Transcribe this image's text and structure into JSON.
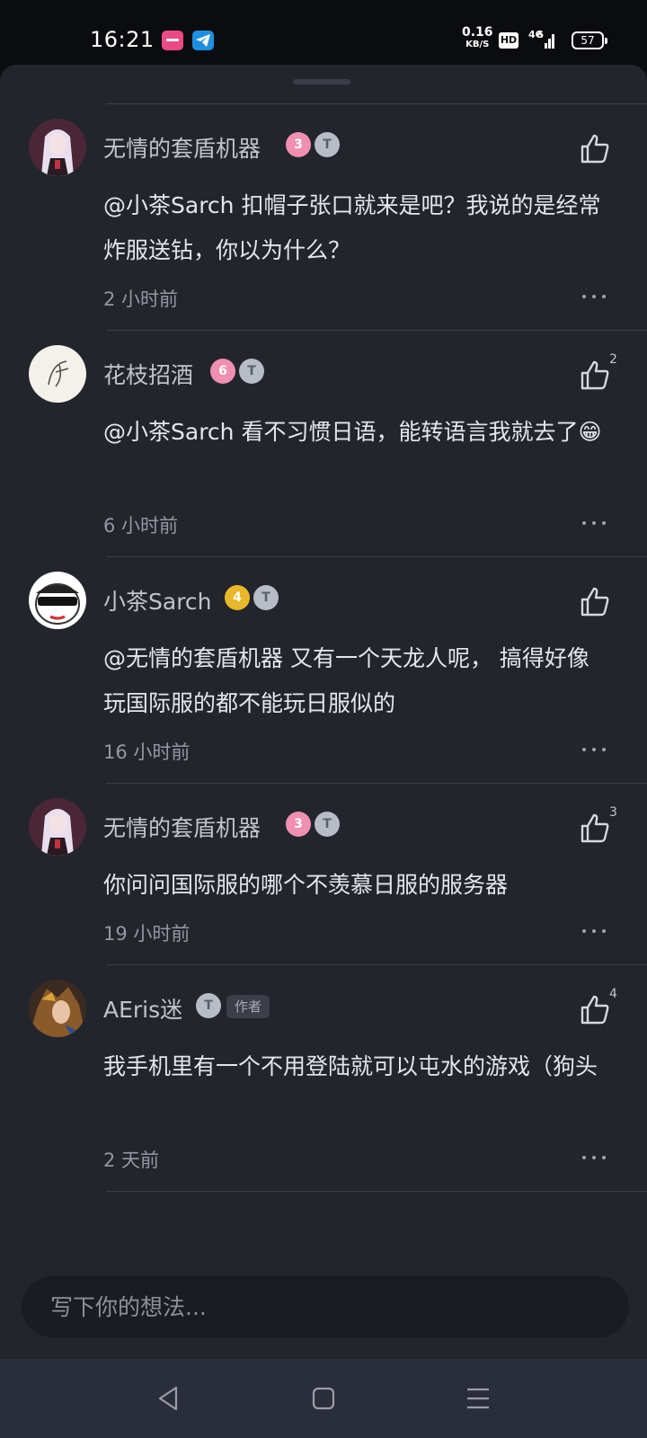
{
  "status_bar": {
    "time": "16:21",
    "app_icons": [
      "app-icon-pink",
      "telegram-icon"
    ],
    "net_speed": "0.16",
    "net_unit": "KB/S",
    "hd": "HD",
    "network": "4G",
    "battery": "57"
  },
  "comments": [
    {
      "username": "无情的套盾机器",
      "level_badge": "3",
      "title_badge": "T",
      "mention": "@小茶Sarch",
      "text": " 扣帽子张口就来是吧？我说的是经常炸服送钻，你以为什么？",
      "time": "2 小时前",
      "likes": ""
    },
    {
      "username": "花枝招酒",
      "level_badge": "6",
      "title_badge": "T",
      "mention": "@小茶Sarch",
      "text": " 看不习惯日语，能转语言我就去了😁",
      "time": "6 小时前",
      "likes": "2"
    },
    {
      "username": "小茶Sarch",
      "level_badge": "4",
      "title_badge": "T",
      "mention": "@无情的套盾机器",
      "text": " 又有一个天龙人呢， 搞得好像玩国际服的都不能玩日服似的",
      "time": "16 小时前",
      "likes": ""
    },
    {
      "username": "无情的套盾机器",
      "level_badge": "3",
      "title_badge": "T",
      "mention": "",
      "text": "你问问国际服的哪个不羡慕日服的服务器",
      "time": "19 小时前",
      "likes": "3"
    },
    {
      "username": "AEris迷",
      "level_badge": "",
      "title_badge": "T",
      "author_tag": "作者",
      "mention": "",
      "text": "我手机里有一个不用登陆就可以屯水的游戏（狗头",
      "time": "2 天前",
      "likes": "4"
    }
  ],
  "input": {
    "placeholder": "写下你的想法..."
  },
  "colors": {
    "sheet_bg": "#23252d",
    "badge_pink": "#f08fb0",
    "badge_gold": "#e9b82a",
    "badge_silver": "#b7bcc7"
  }
}
